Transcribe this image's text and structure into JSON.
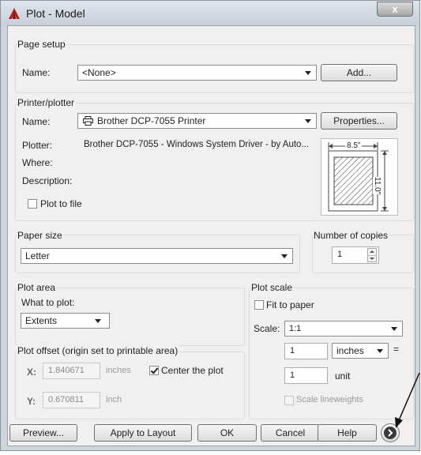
{
  "window": {
    "title": "Plot - Model",
    "close_label": "x"
  },
  "page_setup": {
    "group_label": "Page setup",
    "name_label": "Name:",
    "name_value": "<None>",
    "add_button": "Add..."
  },
  "printer": {
    "group_label": "Printer/plotter",
    "name_label": "Name:",
    "name_value": "Brother DCP-7055 Printer",
    "properties_button": "Properties...",
    "plotter_label": "Plotter:",
    "plotter_value": "Brother DCP-7055  - Windows System Driver - by Auto...",
    "where_label": "Where:",
    "description_label": "Description:",
    "plot_to_file_label": "Plot to file",
    "plot_to_file_checked": false,
    "preview_width": "8.5\"",
    "preview_height": "11.0\""
  },
  "paper_size": {
    "group_label": "Paper size",
    "value": "Letter"
  },
  "copies": {
    "group_label": "Number of copies",
    "value": "1"
  },
  "plot_area": {
    "group_label": "Plot area",
    "what_label": "What to plot:",
    "what_value": "Extents"
  },
  "plot_scale": {
    "group_label": "Plot scale",
    "fit_label": "Fit to paper",
    "fit_checked": false,
    "scale_label": "Scale:",
    "scale_value": "1:1",
    "value1": "1",
    "unit1": "inches",
    "equals": "=",
    "value2": "1",
    "unit2": "unit",
    "lineweights_label": "Scale lineweights",
    "lineweights_checked": false
  },
  "plot_offset": {
    "group_label": "Plot offset (origin set to printable area)",
    "x_label": "X:",
    "x_value": "1.840671",
    "x_unit": "inches",
    "center_label": "Center the plot",
    "center_checked": true,
    "y_label": "Y:",
    "y_value": "0.670811",
    "y_unit": "inch"
  },
  "buttons": {
    "preview": "Preview...",
    "apply": "Apply to Layout",
    "ok": "OK",
    "cancel": "Cancel",
    "help": "Help"
  }
}
